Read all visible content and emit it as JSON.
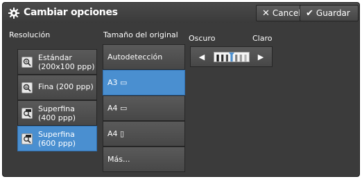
{
  "window": {
    "title": "Cambiar opciones"
  },
  "toolbar": {
    "cancel_label": "Cancelar",
    "save_label": "Guardar"
  },
  "resolution": {
    "label": "Resolución",
    "options": [
      {
        "line1": "Estándar",
        "line2": "(200x100 ppp)",
        "selected": false
      },
      {
        "line1": "Fina (200 ppp)",
        "line2": "",
        "selected": false
      },
      {
        "line1": "Superfina",
        "line2": "(400 ppp)",
        "selected": false
      },
      {
        "line1": "Superfina",
        "line2": "(600 ppp)",
        "selected": true
      }
    ]
  },
  "original_size": {
    "label": "Tamaño del original",
    "options": [
      {
        "label": "Autodetección",
        "selected": false
      },
      {
        "label": "A3 ▭",
        "selected": true
      },
      {
        "label": "A4 ▭",
        "selected": false
      },
      {
        "label": "A4 ▯",
        "selected": false
      },
      {
        "label": "Más...",
        "selected": false
      }
    ]
  },
  "density": {
    "dark_label": "Oscuro",
    "light_label": "Claro",
    "level": 4,
    "steps": 7
  },
  "colors": {
    "selected": "#4a8fd0",
    "panel": "#3b3b3b",
    "button": "#4f4f4f"
  }
}
